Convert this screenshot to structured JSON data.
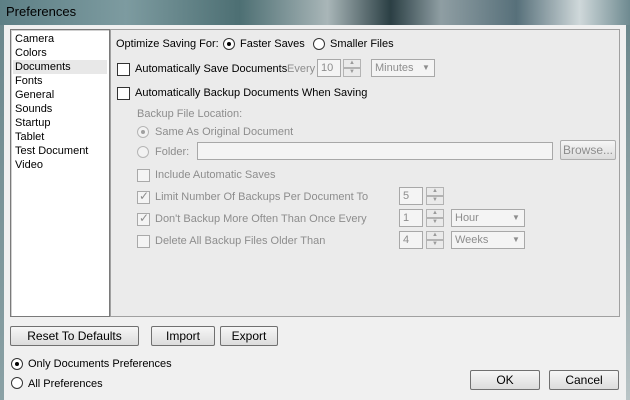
{
  "window": {
    "title": "Preferences"
  },
  "categories": [
    {
      "label": "Camera"
    },
    {
      "label": "Colors"
    },
    {
      "label": "Documents",
      "selected": true
    },
    {
      "label": "Fonts"
    },
    {
      "label": "General"
    },
    {
      "label": "Sounds"
    },
    {
      "label": "Startup"
    },
    {
      "label": "Tablet"
    },
    {
      "label": "Test Document"
    },
    {
      "label": "Video"
    }
  ],
  "documents": {
    "optimize_label": "Optimize Saving For:",
    "optimize_options": {
      "faster": "Faster Saves",
      "smaller": "Smaller Files"
    },
    "optimize_selected": "faster",
    "autosave": {
      "label": "Automatically Save Documents",
      "every_label": "Every",
      "value": "10",
      "unit": "Minutes",
      "checked": false
    },
    "autobackup": {
      "label": "Automatically Backup Documents When Saving",
      "checked": false
    },
    "backup_location_label": "Backup File Location:",
    "location_same": "Same As Original Document",
    "location_folder": "Folder:",
    "folder_value": "",
    "browse_label": "Browse...",
    "include_autosaves": {
      "label": "Include Automatic Saves",
      "checked": false
    },
    "limit_backups": {
      "label": "Limit Number Of Backups Per Document To",
      "checked": true,
      "value": "5"
    },
    "dont_backup": {
      "label": "Don't Backup More Often Than Once Every",
      "checked": true,
      "value": "1",
      "unit": "Hour"
    },
    "delete_older": {
      "label": "Delete All Backup Files Older Than",
      "checked": false,
      "value": "4",
      "unit": "Weeks"
    }
  },
  "footer": {
    "reset_label": "Reset To Defaults",
    "import_label": "Import",
    "export_label": "Export",
    "only_docs_label": "Only Documents Preferences",
    "all_prefs_label": "All Preferences",
    "scope_selected": "only_docs",
    "ok_label": "OK",
    "cancel_label": "Cancel"
  }
}
